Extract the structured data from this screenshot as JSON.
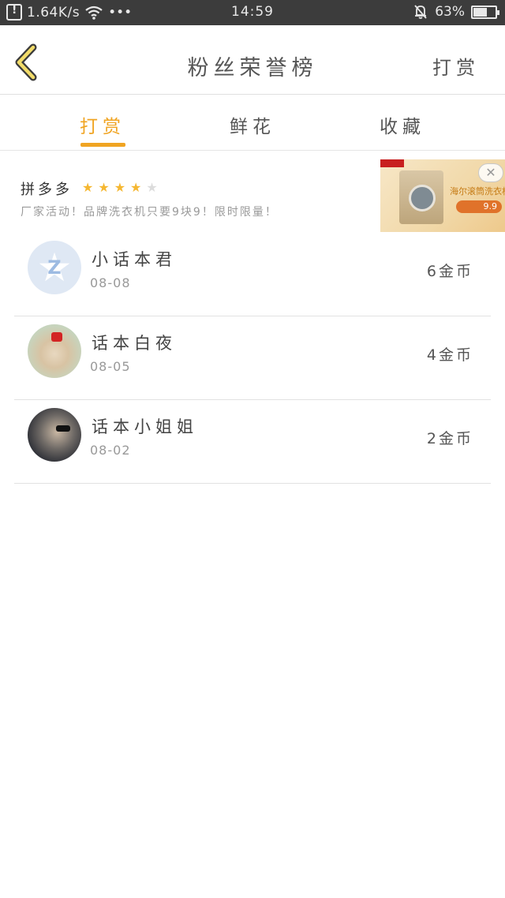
{
  "status_bar": {
    "speed": "1.64K/s",
    "dots": "•••",
    "time": "14:59",
    "battery": "63%",
    "battery_level": 0.63
  },
  "header": {
    "title": "粉丝荣誉榜",
    "action": "打赏"
  },
  "tabs": [
    {
      "label": "打赏",
      "active": true
    },
    {
      "label": "鲜花",
      "active": false
    },
    {
      "label": "收藏",
      "active": false
    }
  ],
  "ad": {
    "brand": "拼多多",
    "rating": 4,
    "rating_max": 5,
    "description": "厂家活动！品牌洗衣机只要9块9！限时限量！",
    "image_headline": "海尔滚筒洗衣机",
    "image_price": "9.9",
    "close_symbol": "✕"
  },
  "list": [
    {
      "name": "小话本君",
      "date": "08-08",
      "coins": "6金币"
    },
    {
      "name": "话本白夜",
      "date": "08-05",
      "coins": "4金币"
    },
    {
      "name": "话本小姐姐",
      "date": "08-02",
      "coins": "2金币"
    }
  ],
  "colors": {
    "accent": "#f0a422",
    "status_bar": "#3c3c3c",
    "divider": "#e2e2e2"
  }
}
